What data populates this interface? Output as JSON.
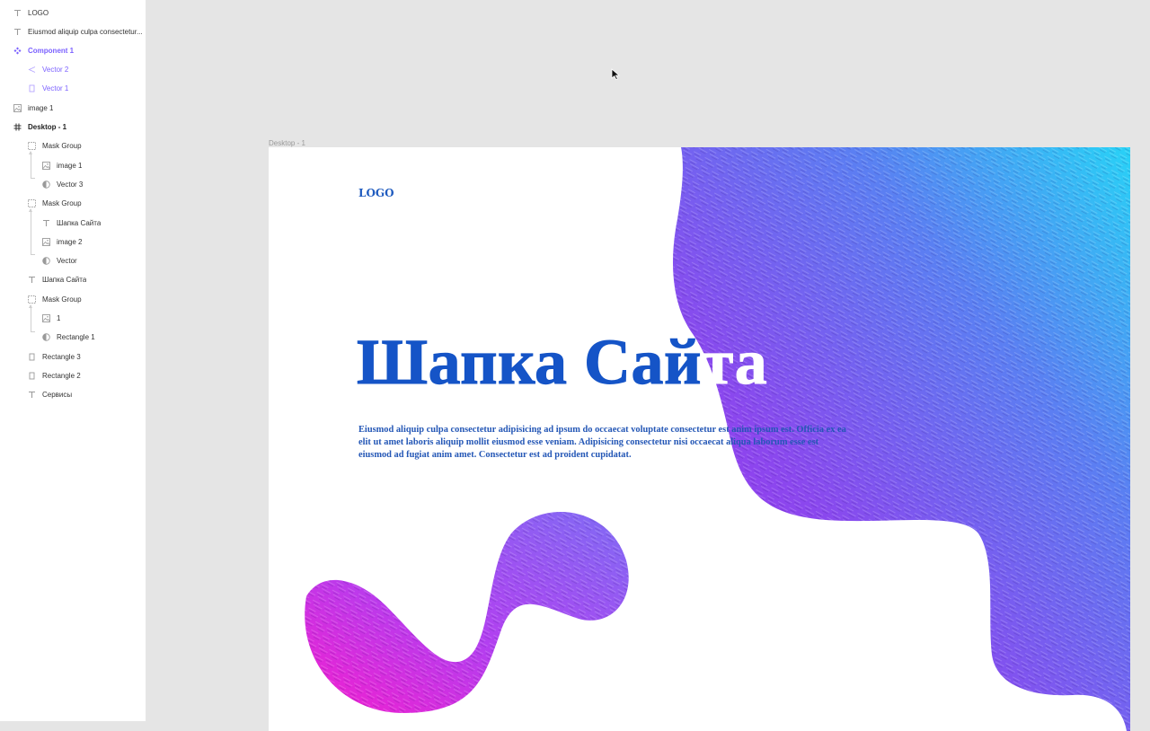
{
  "layers": [
    {
      "name": "LOGO",
      "type": "text"
    },
    {
      "name": "Eiusmod aliquip culpa consectetur...",
      "type": "text"
    },
    {
      "name": "Component 1",
      "type": "component"
    },
    {
      "name": "Vector 2",
      "type": "vector"
    },
    {
      "name": "Vector 1",
      "type": "rect"
    },
    {
      "name": "image 1",
      "type": "image"
    },
    {
      "name": "Desktop - 1",
      "type": "frame"
    },
    {
      "name": "Mask Group",
      "type": "mask-group"
    },
    {
      "name": "image 1",
      "type": "image"
    },
    {
      "name": "Vector 3",
      "type": "mask"
    },
    {
      "name": "Mask Group",
      "type": "mask-group"
    },
    {
      "name": "Шапка Сайта",
      "type": "text"
    },
    {
      "name": "image 2",
      "type": "image"
    },
    {
      "name": "Vector",
      "type": "mask"
    },
    {
      "name": "Шапка Сайта",
      "type": "text"
    },
    {
      "name": "Mask Group",
      "type": "mask-group"
    },
    {
      "name": "1",
      "type": "image"
    },
    {
      "name": "Rectangle 1",
      "type": "mask"
    },
    {
      "name": "Rectangle 3",
      "type": "rect"
    },
    {
      "name": "Rectangle 2",
      "type": "rect"
    },
    {
      "name": "Сервисы",
      "type": "text"
    }
  ],
  "canvas": {
    "frame_label": "Desktop - 1",
    "logo": "LOGO",
    "hero_title_dark": "Шапка Сай",
    "hero_title_light": "та",
    "hero_text": "Eiusmod aliquip culpa consectetur adipisicing ad ipsum do occaecat voluptate consectetur est anim ipsum est. Officia ex ea elit ut amet laboris aliquip mollit eiusmod esse veniam. Adipisicing consectetur nisi occaecat aliqua laborum esse est eiusmod ad fugiat anim amet. Consectetur est ad proident cupidatat."
  },
  "colors": {
    "canvas_bg": "#e5e5e5",
    "accent_purple": "#7b61ff",
    "title_blue": "#1554c7",
    "gradient_violet": "#8a3cf0",
    "gradient_blue": "#4f80f2",
    "gradient_cyan": "#2ad0f5",
    "gradient_magenta": "#f01fd2"
  }
}
